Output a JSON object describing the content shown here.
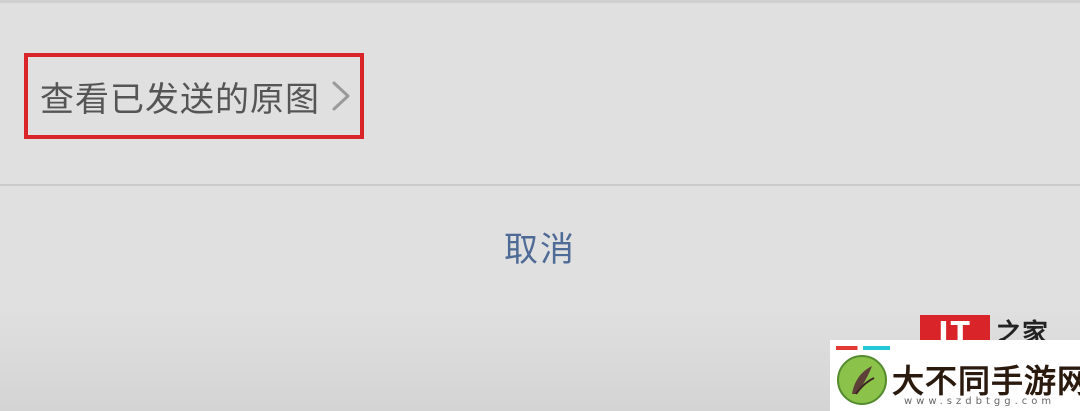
{
  "sheet": {
    "option_label": "查看已发送的原图",
    "cancel_label": "取消"
  },
  "icons": {
    "chevron": "chevron-right-icon",
    "leaf": "leaf-icon"
  },
  "colors": {
    "highlight_border": "#d9252a",
    "cancel_text": "#4e6a96",
    "option_text": "#555555"
  },
  "watermarks": {
    "ithome_mark": "IT",
    "ithome_text": "之家",
    "site_title": "大不同手游网",
    "site_domain": "www.szdbtgg.com"
  }
}
